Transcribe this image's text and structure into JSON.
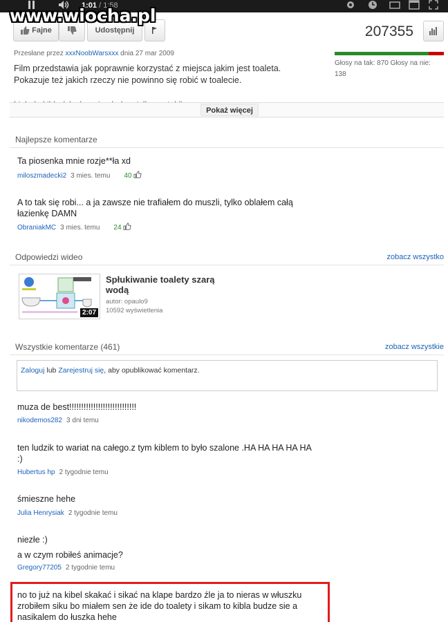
{
  "watermark": "www.wiocha.pl",
  "player": {
    "current_time": "1:01",
    "separator": " / ",
    "total_time": "1:58"
  },
  "actions": {
    "like_label": "Fajne",
    "share_label": "Udostępnij"
  },
  "views": "207355",
  "uploader": {
    "prefix": "Przesłane przez ",
    "name": "xxxNoobWarsxxx",
    "date": " dnia 27 mar 2009"
  },
  "description": {
    "line1": "Film przedstawia jak poprawnie korzystać z miejsca jakim jest toaleta.",
    "line2": "Pokazuje też jakich rzeczy nie powinno się robić w toalecie.",
    "cut": "Link do kibla (słucham i oglądam tylko na taki)"
  },
  "votes": {
    "text": "Głosy na tak: 870 Głosy na nie: 138",
    "like_fraction": 0.863
  },
  "show_more_label": "Pokaż więcej",
  "best_comments": {
    "heading": "Najlepsze komentarze",
    "items": [
      {
        "text": "Ta piosenka mnie rozje**ła xd",
        "user": "miloszmadecki2",
        "time": "3 mies. temu",
        "points": "40"
      },
      {
        "text": "A to tak się robi... a ja zawsze nie trafiałem do muszli, tylko oblałem całą łazienkę DAMN",
        "user": "ObraniakMC",
        "time": "3 mies. temu",
        "points": "24"
      }
    ]
  },
  "video_responses": {
    "heading": "Odpowiedzi wideo",
    "see_all": "zobacz wszystko",
    "video": {
      "title": "Spłukiwanie toalety szarą wodą",
      "author": "autor: opaulo9",
      "views": "10592 wyświetlenia",
      "duration": "2:07"
    }
  },
  "all_comments": {
    "heading": "Wszystkie komentarze (461)",
    "see_all": "zobacz wszystkie",
    "login": {
      "login_link": "Zaloguj",
      "or": " lub ",
      "register_link": "Zarejestruj się",
      "rest": ", aby opublikować komentarz."
    },
    "items": [
      {
        "text": "muza de best!!!!!!!!!!!!!!!!!!!!!!!!!!!!",
        "user": "nikodemos282",
        "time": "3 dni temu"
      },
      {
        "text": "ten ludzik to wariat na całego.z tym kiblem to było szalone .HA HA HA HA HA :)",
        "user": "Hubertus hp",
        "time": "2 tygodnie temu"
      },
      {
        "text": "śmieszne hehe",
        "user": "Julia Henrysiak",
        "time": "2 tygodnie temu"
      },
      {
        "text1": "niezłe :)",
        "text2": "a w czym robiłeś animacje?",
        "user": "Gregory77205",
        "time": "2 tygodnie temu"
      },
      {
        "text": "no to już na kibel skakać i sikać na klape bardzo źle ja to nieras w włuszku zrobiłem siku bo miałem sen że ide do toalety i sikam to kibla budze sie a nasikalem do łuszka hehe"
      }
    ]
  }
}
